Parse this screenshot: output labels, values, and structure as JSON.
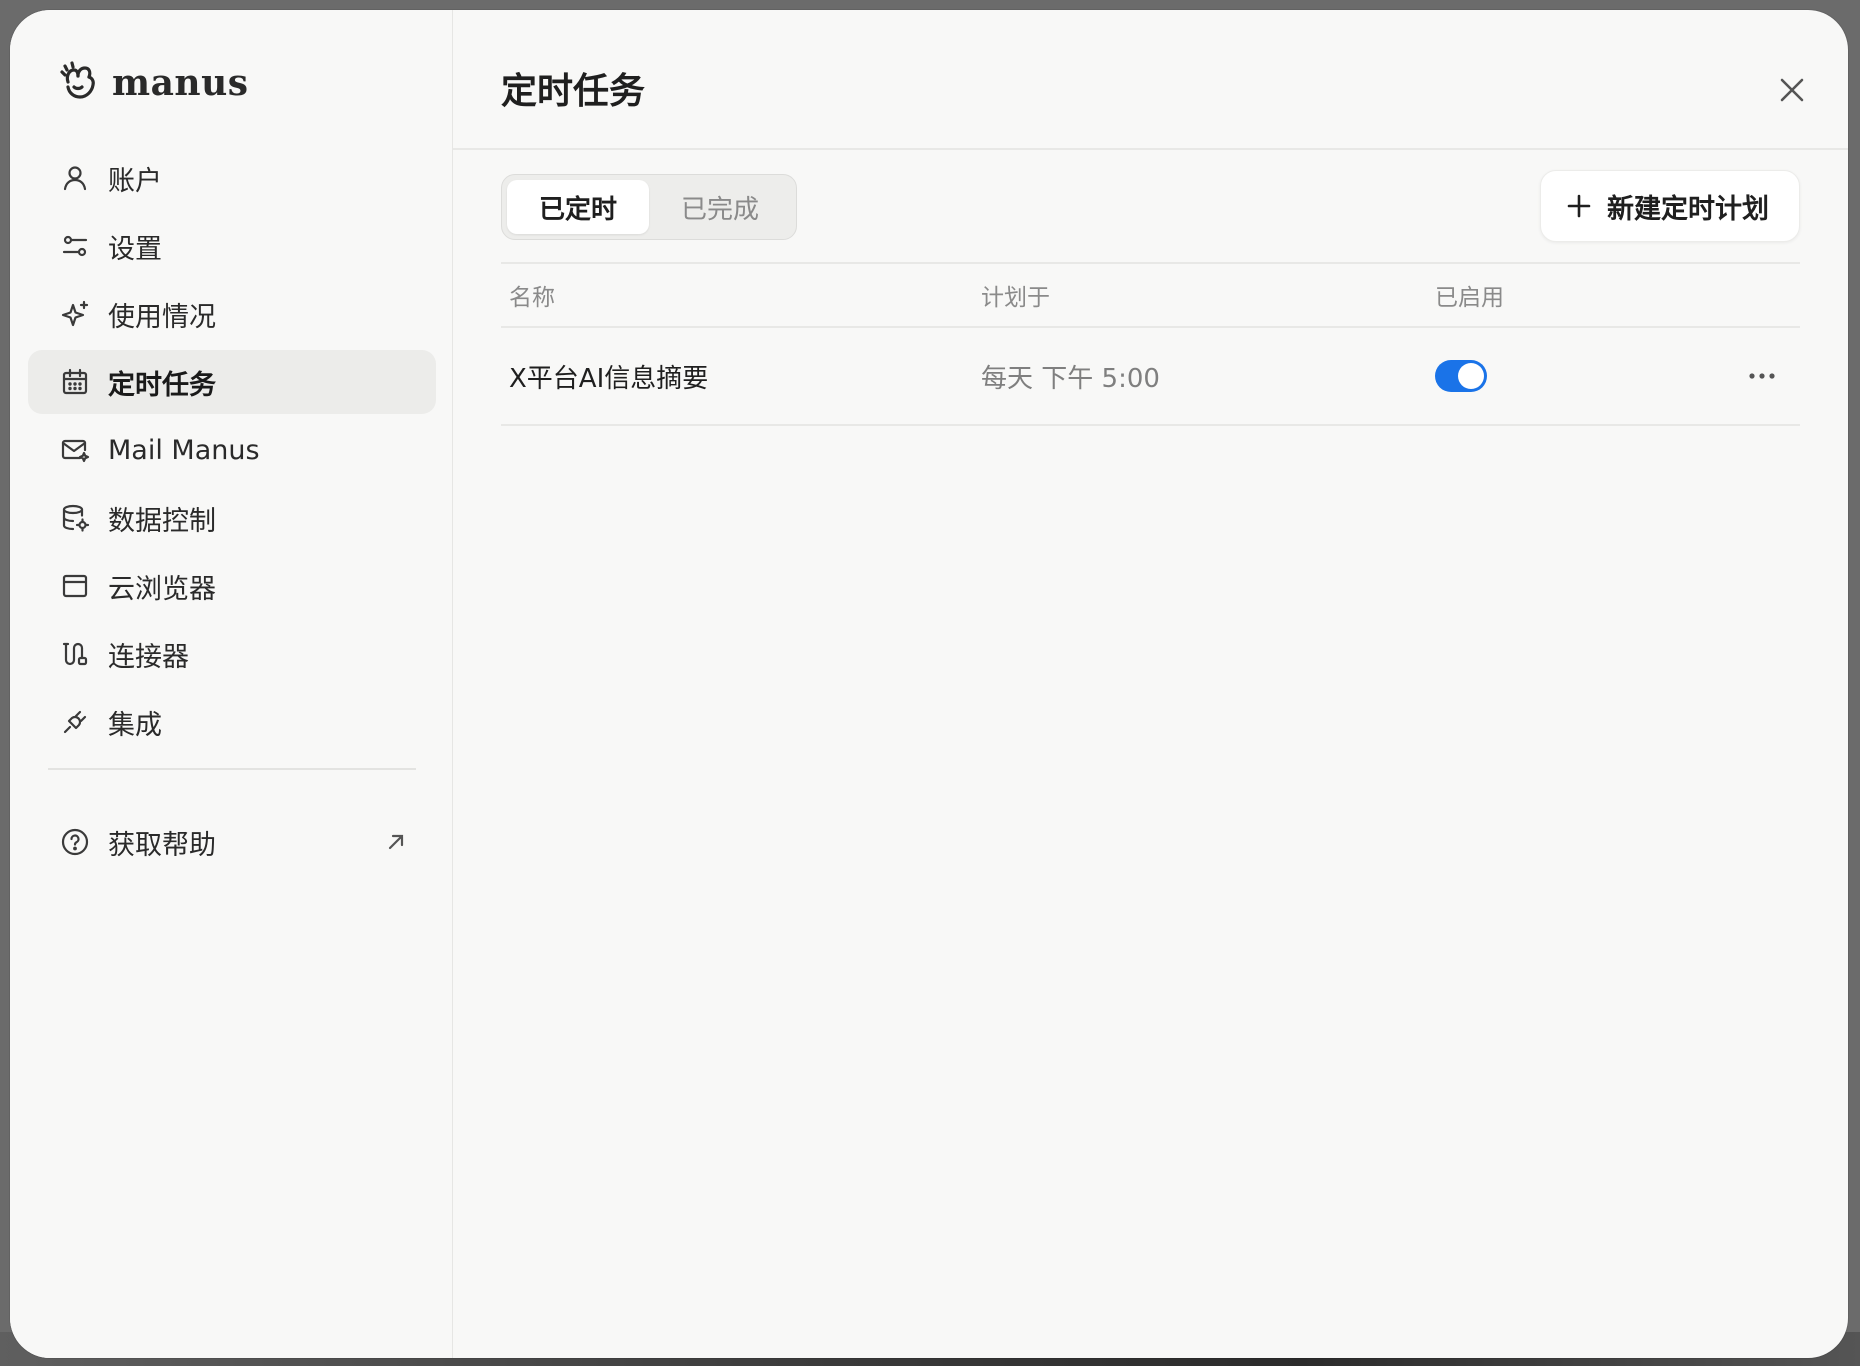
{
  "brand": {
    "name": "manus"
  },
  "sidebar": {
    "items": [
      {
        "label": "账户",
        "icon": "user-icon"
      },
      {
        "label": "设置",
        "icon": "sliders-icon"
      },
      {
        "label": "使用情况",
        "icon": "sparkle-icon"
      },
      {
        "label": "定时任务",
        "icon": "calendar-icon",
        "active": true
      },
      {
        "label": "Mail Manus",
        "icon": "mail-icon"
      },
      {
        "label": "数据控制",
        "icon": "database-gear-icon"
      },
      {
        "label": "云浏览器",
        "icon": "browser-window-icon"
      },
      {
        "label": "连接器",
        "icon": "connector-icon"
      },
      {
        "label": "集成",
        "icon": "plug-icon"
      }
    ],
    "help": {
      "label": "获取帮助",
      "icon": "help-circle-icon",
      "external_icon": "arrow-up-right-icon"
    }
  },
  "main": {
    "title": "定时任务",
    "tabs": [
      {
        "label": "已定时",
        "active": true
      },
      {
        "label": "已完成",
        "active": false
      }
    ],
    "new_button": {
      "label": "新建定时计划",
      "icon": "plus-icon"
    },
    "table": {
      "headers": [
        "名称",
        "计划于",
        "已启用"
      ],
      "rows": [
        {
          "name": "X平台AI信息摘要",
          "schedule": "每天 下午 5:00",
          "enabled": true
        }
      ]
    }
  },
  "colors": {
    "accent": "#1a73e8",
    "background": "#f8f8f7",
    "active_nav": "#ececea"
  }
}
